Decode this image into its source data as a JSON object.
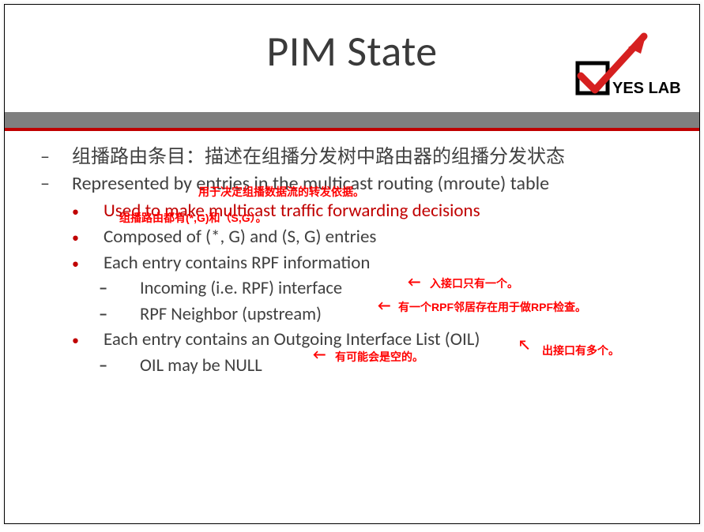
{
  "title": "PIM State",
  "logo_text": "YES LAB",
  "bullets": {
    "l1_a": "组播路由条目：描述在组播分发树中路由器的组播分发状态",
    "l1_b": "Represented by entries in the multicast routing (mroute) table",
    "l2_a": "Used to make multicast traffic forwarding decisions",
    "l2_b": "Composed of (*, G) and (S, G) entries",
    "l2_c": "Each entry contains RPF information",
    "l3_a": "Incoming (i.e. RPF) interface",
    "l3_b": "RPF Neighbor (upstream)",
    "l2_d": "Each entry contains an Outgoing Interface List (OIL)",
    "l3_c": "OIL may be NULL"
  },
  "annotations": {
    "a1": "用于决定组播数据流的转发依据。",
    "a2": "组播路由都有(*,G)和（S,G）。",
    "a3": "入接口只有一个。",
    "a4": "有一个RPF邻居存在用于做RPF检查。",
    "a5": "出接口有多个。",
    "a6": "有可能会是空的。"
  }
}
